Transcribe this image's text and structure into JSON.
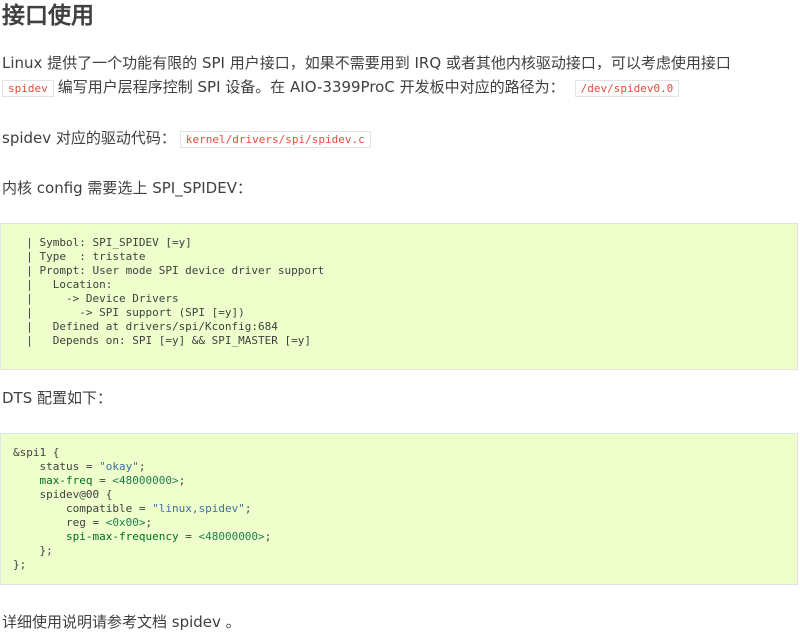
{
  "heading": "接口使用",
  "intro": {
    "text1": "Linux 提供了一个功能有限的 SPI 用户接口，如果不需要用到 IRQ 或者其他内核驱动接口，可以考虑使用接口",
    "code1": "spidev",
    "text2": "编写用户层程序控制 SPI 设备。在 AIO-3399ProC 开发板中对应的路径为：",
    "code2": "/dev/spidev0.0"
  },
  "driver": {
    "text": "spidev 对应的驱动代码：",
    "code": "kernel/drivers/spi/spidev.c"
  },
  "config_intro": "内核 config 需要选上 SPI_SPIDEV：",
  "config_block": [
    "  | Symbol: SPI_SPIDEV [=y]",
    "  | Type  : tristate",
    "  | Prompt: User mode SPI device driver support",
    "  |   Location:",
    "  |     -> Device Drivers",
    "  |       -> SPI support (SPI [=y])",
    "  |   Defined at drivers/spi/Kconfig:684",
    "  |   Depends on: SPI [=y] && SPI_MASTER [=y]"
  ],
  "dts_intro": "DTS 配置如下：",
  "dts_block": {
    "l1": "&spi1 {",
    "l2_key": "status",
    "l2_val": "\"okay\"",
    "l3_key": "max-freq",
    "l3_val": "<48000000>",
    "l4": "spidev@00 {",
    "l5_key": "compatible",
    "l5_val": "\"linux,spidev\"",
    "l6_key": "reg",
    "l6_val": "<0x00>",
    "l7_key": "spi-max-frequency",
    "l7_val": "<48000000>",
    "l8": "};",
    "l9": "};"
  },
  "footer": "详细使用说明请参考文档 spidev 。"
}
